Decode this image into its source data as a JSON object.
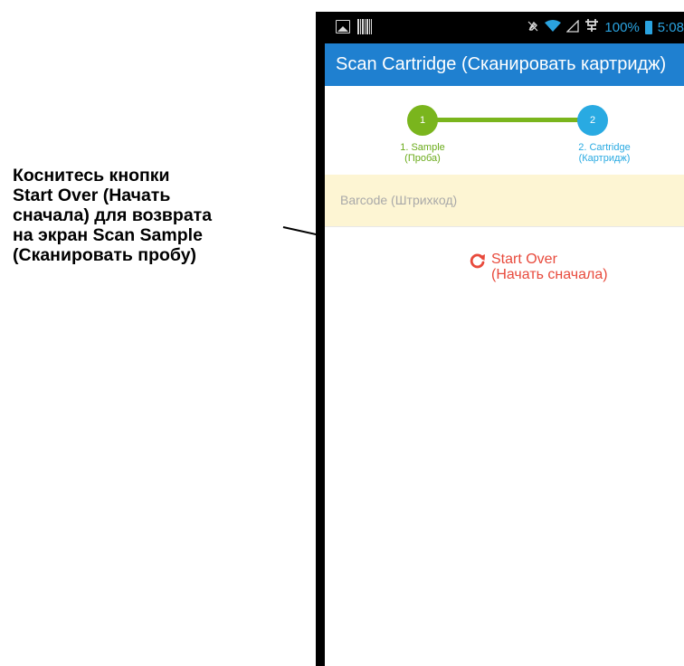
{
  "callout": {
    "lines": [
      "Коснитесь кнопки",
      "Start Over (Начать",
      "сначала) для возврата",
      "на экран Scan Sample",
      "(Сканировать пробу)"
    ]
  },
  "status_bar": {
    "icons": [
      "image-icon",
      "barcode-icon",
      "mute-icon",
      "wifi-icon",
      "signal-icon",
      "network-icon",
      "battery-icon"
    ],
    "battery": "100%",
    "time": "5:08"
  },
  "app_bar": {
    "title": "Scan Cartridge (Сканировать картридж)"
  },
  "stepper": {
    "steps": [
      {
        "number": "1",
        "label": "1. Sample",
        "sublabel": "(Проба)",
        "color": "#7ab51d"
      },
      {
        "number": "2",
        "label": "2. Cartridge",
        "sublabel": "(Картридж)",
        "color": "#29aae2"
      }
    ]
  },
  "barcode": {
    "label": "Barcode",
    "label_ru": "(Штрихкод)"
  },
  "start_over": {
    "label": "Start Over",
    "label_ru": "(Начать сначала)",
    "icon": "refresh-icon",
    "color": "#e84a3c"
  },
  "colors": {
    "app_bar": "#1f80d0",
    "barcode_row": "#fdf5d3"
  }
}
